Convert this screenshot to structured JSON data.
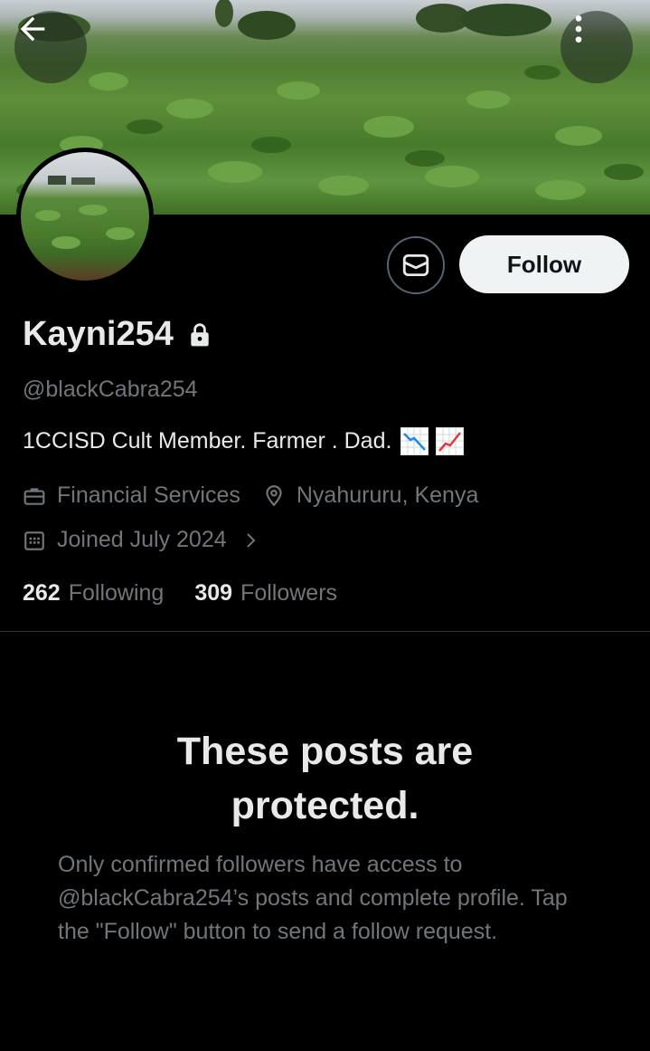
{
  "header": {
    "back_icon": "arrow-left-icon",
    "more_icon": "more-vertical-icon"
  },
  "profile": {
    "display_name": "Kayni254",
    "handle": "@blackCabra254",
    "bio_text": "1CCISD Cult Member. Farmer . Dad.",
    "bio_emojis": [
      "chart-decreasing-emoji",
      "chart-increasing-emoji"
    ],
    "category": "Financial Services",
    "location": "Nyahururu, Kenya",
    "joined": "Joined July 2024",
    "protected": true
  },
  "actions": {
    "follow_label": "Follow",
    "message_icon": "envelope-icon"
  },
  "stats": {
    "following_count": "262",
    "following_label": "Following",
    "followers_count": "309",
    "followers_label": "Followers"
  },
  "protected_notice": {
    "title": "These posts are protected.",
    "body": "Only confirmed followers have access to @blackCabra254’s posts and complete profile. Tap the \"Follow\" button to send a follow request."
  },
  "colors": {
    "background": "#000000",
    "primary_text": "#e7e9ea",
    "secondary_text": "#71767b",
    "follow_button_bg": "#eff3f4",
    "border": "#536471"
  }
}
